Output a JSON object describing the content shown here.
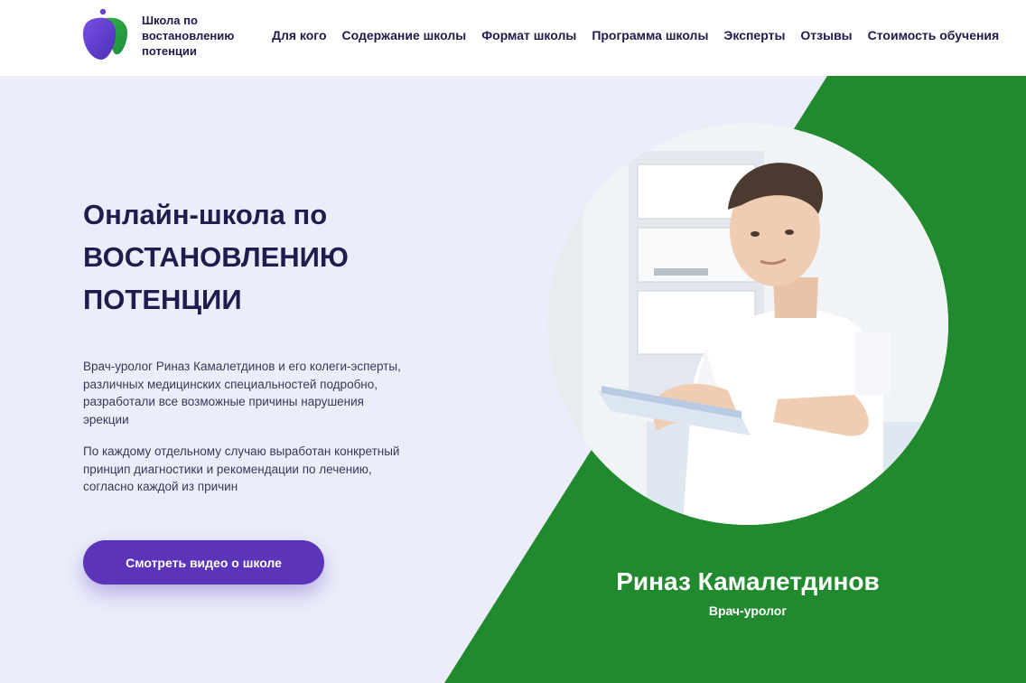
{
  "header": {
    "logo_text_lines": [
      "Школа по",
      "востановлению",
      "потенции"
    ],
    "nav": [
      "Для кого",
      "Содержание школы",
      "Формат школы",
      "Программа школы",
      "Эксперты",
      "Отзывы",
      "Стоимость обучения"
    ]
  },
  "hero": {
    "headline_line1": "Онлайн-школа по",
    "headline_line2": "ВОСТАНОВЛЕНИЮ",
    "headline_line3": "ПОТЕНЦИИ",
    "paragraph1": "Врач-уролог Риназ Камалетдинов и его колеги-эсперты, различных медицинских специальностей подробно, разработали все возможные причины нарушения эрекции",
    "paragraph2": "По каждому отдельному случаю выработан конкретный принцип диагностики и рекомендации по лечению, согласно каждой из причин",
    "cta_label": "Смотреть видео о школе"
  },
  "doctor": {
    "name": "Риназ Камалетдинов",
    "role": "Врач-уролог"
  },
  "colors": {
    "brand_purple": "#5b34b9",
    "accent_green": "#228a2e",
    "hero_background": "#ebeefa",
    "text_dark": "#221b4e"
  },
  "icons": {
    "logo": "tooth-logo-icon"
  }
}
